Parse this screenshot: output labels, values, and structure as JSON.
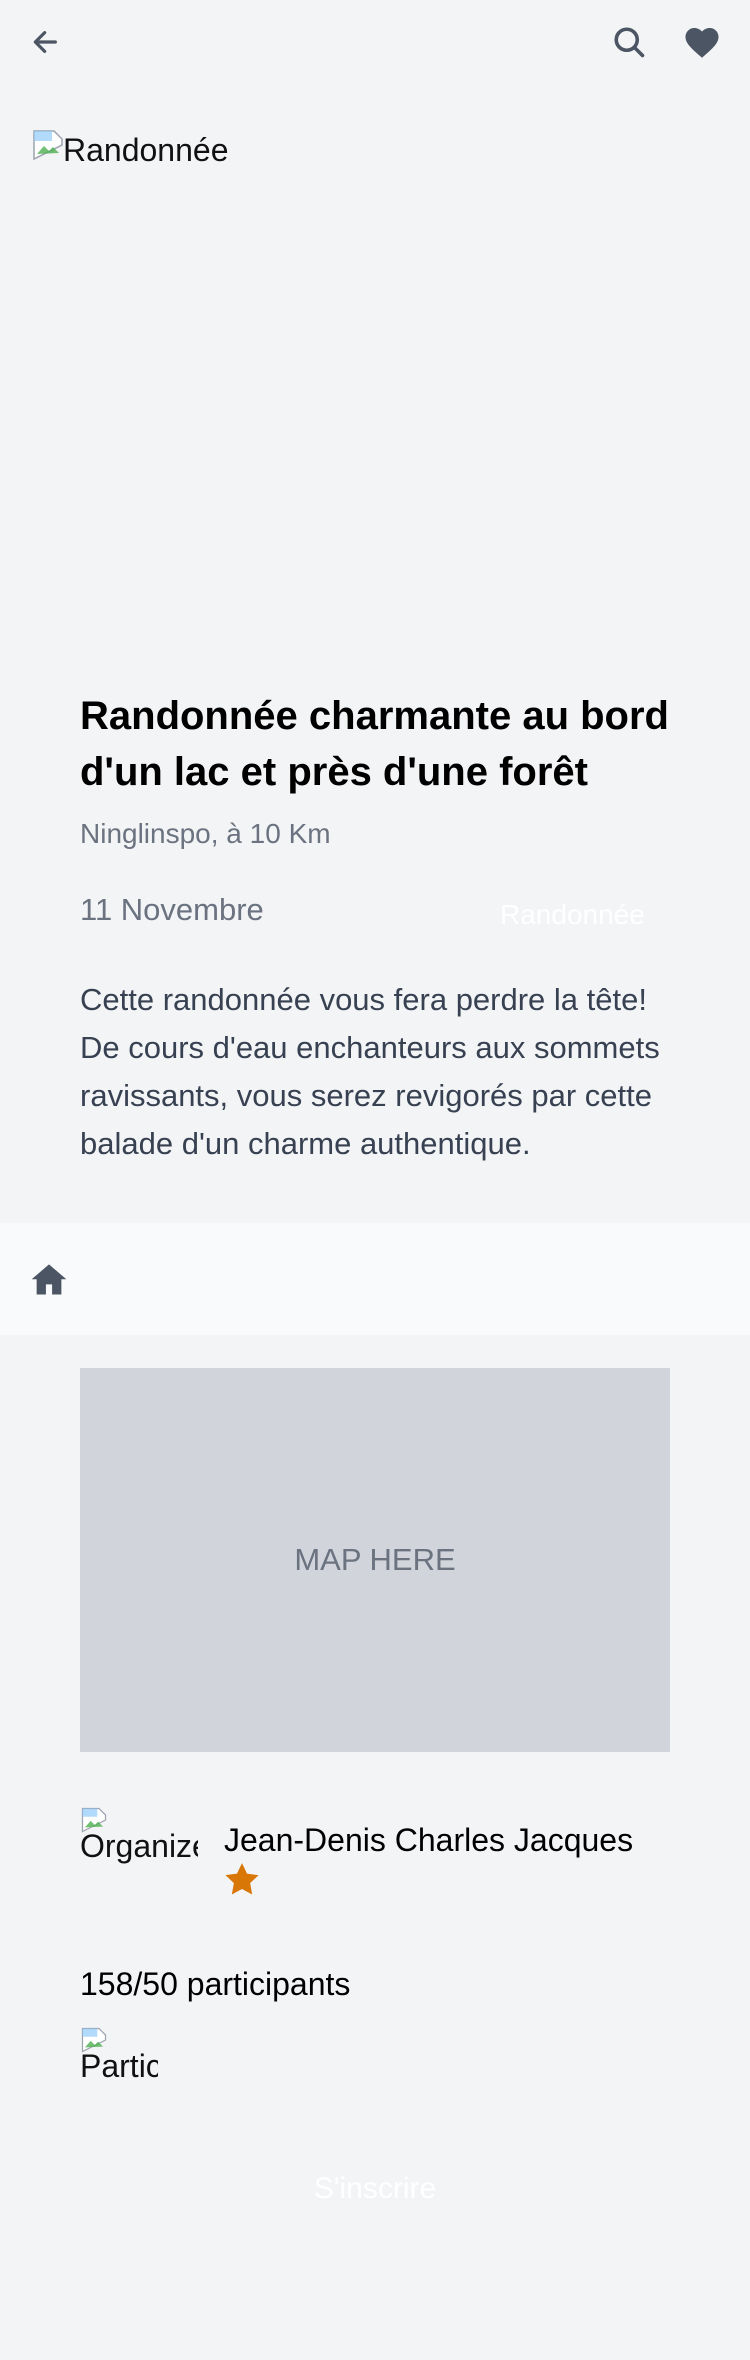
{
  "colors": {
    "page_bg": "#f3f4f6",
    "icon": "#4b5563",
    "muted_text": "#6b7280",
    "map_bg": "#d1d5db",
    "star": "#d97706",
    "nav_bg": "#f9fafb"
  },
  "header": {
    "back_icon": "arrow-left-icon",
    "search_icon": "search-icon",
    "favorite_icon": "heart-icon"
  },
  "hero": {
    "image_alt": "Randonnée"
  },
  "event": {
    "title": "Randonnée charmante au bord d'un lac et près d'une forêt",
    "location": "Ninglinspo, à 10 Km",
    "date": "11 Novembre",
    "category": "Randonnée",
    "description": "Cette randonnée vous fera perdre la tête! De cours d'eau enchanteurs aux sommets ravissants, vous serez revigorés par cette balade d'un charme authentique."
  },
  "nav": {
    "home_icon": "home-icon"
  },
  "map": {
    "placeholder": "MAP HERE"
  },
  "organizer": {
    "image_alt": "Organizer",
    "name": "Jean-Denis Charles Jacques",
    "rating_icon": "star-icon"
  },
  "participants": {
    "count_text": "158/50 participants",
    "image_alt": "Participant"
  },
  "actions": {
    "signup_label": "S'inscrire"
  }
}
